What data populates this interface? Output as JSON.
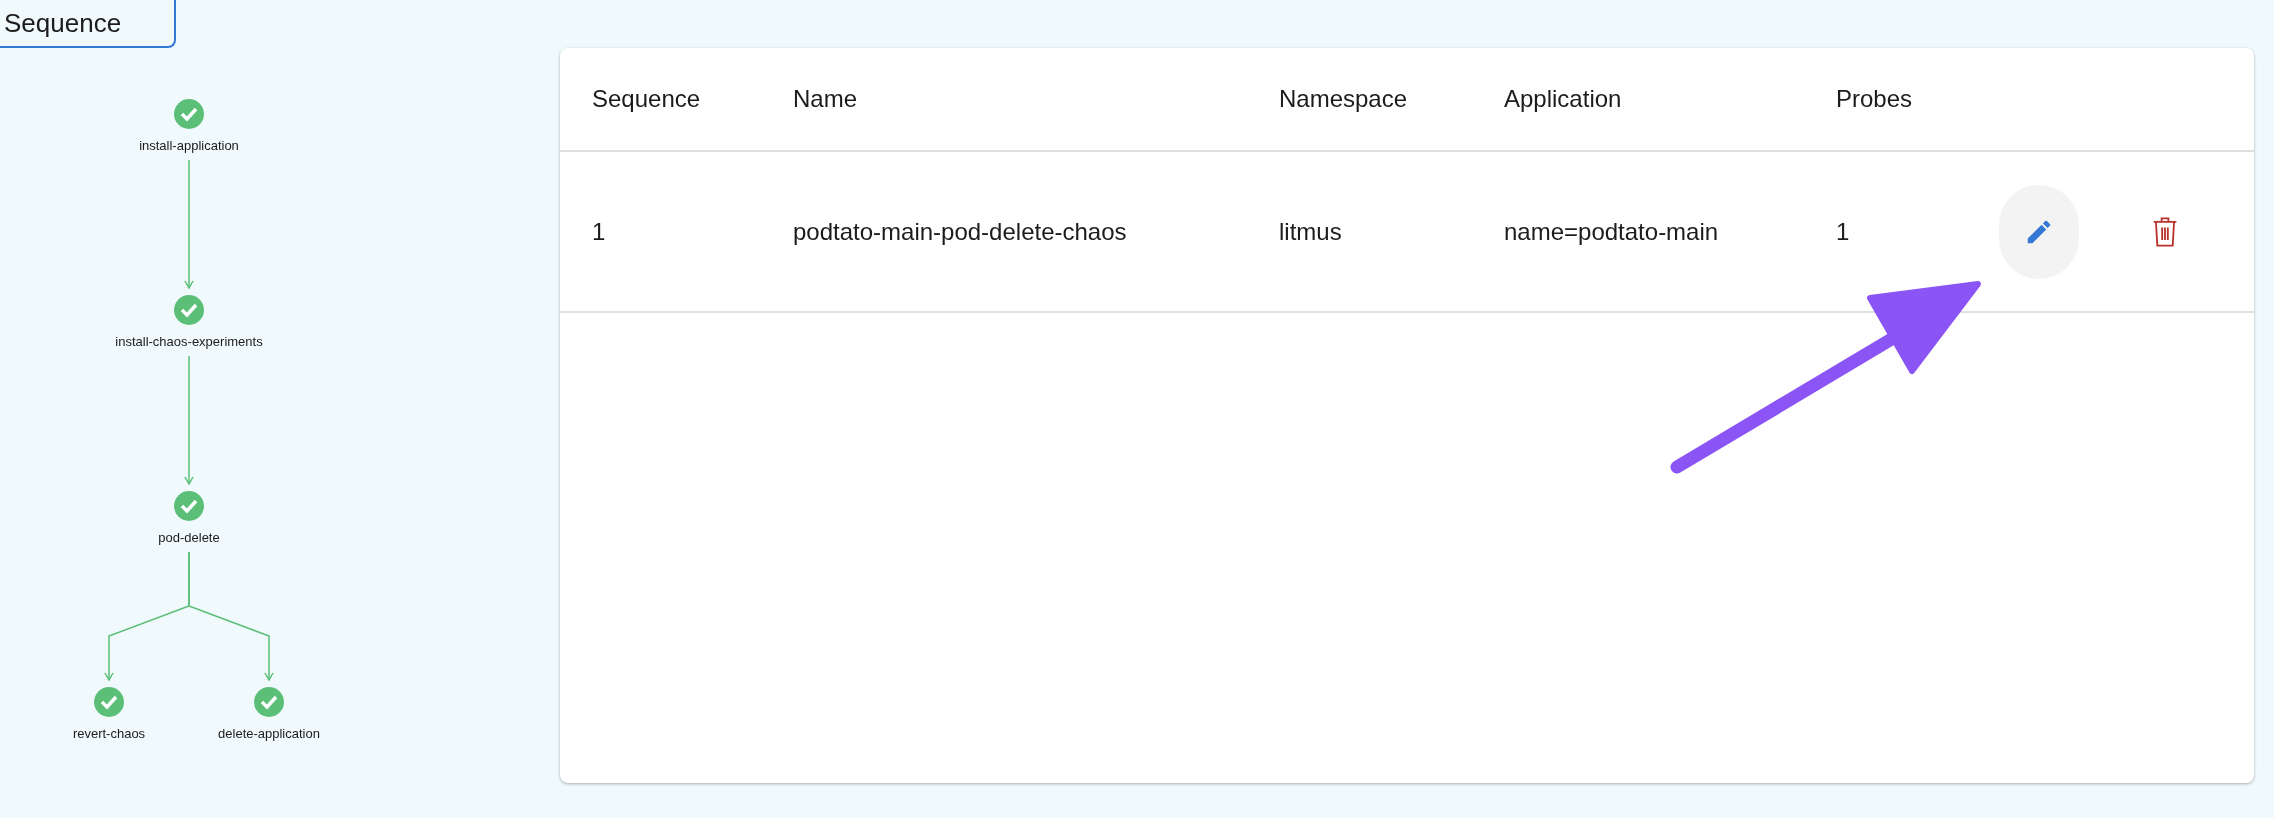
{
  "header_button": {
    "label": "Sequence"
  },
  "workflow": [
    {
      "name": "install-application",
      "kind": "succeeded",
      "children": [
        {
          "name": "install-chaos-experiments",
          "kind": "succeeded",
          "children": [
            {
              "name": "pod-delete",
              "kind": "succeeded",
              "children": [
                {
                  "name": "revert-chaos",
                  "kind": "succeeded"
                },
                {
                  "name": "delete-application",
                  "kind": "succeeded"
                }
              ]
            }
          ]
        }
      ]
    }
  ],
  "table": {
    "columns": [
      "Sequence",
      "Name",
      "Namespace",
      "Application",
      "Probes"
    ],
    "rows": [
      {
        "cells": [
          "1",
          "podtato-main-pod-delete-chaos",
          "litmus",
          "name=podtato-main",
          "1"
        ],
        "actions": [
          {
            "kind": "edit"
          },
          {
            "kind": "delete"
          }
        ]
      }
    ]
  },
  "annotation": {
    "kind": "arrow",
    "color": "#8b55f5"
  }
}
